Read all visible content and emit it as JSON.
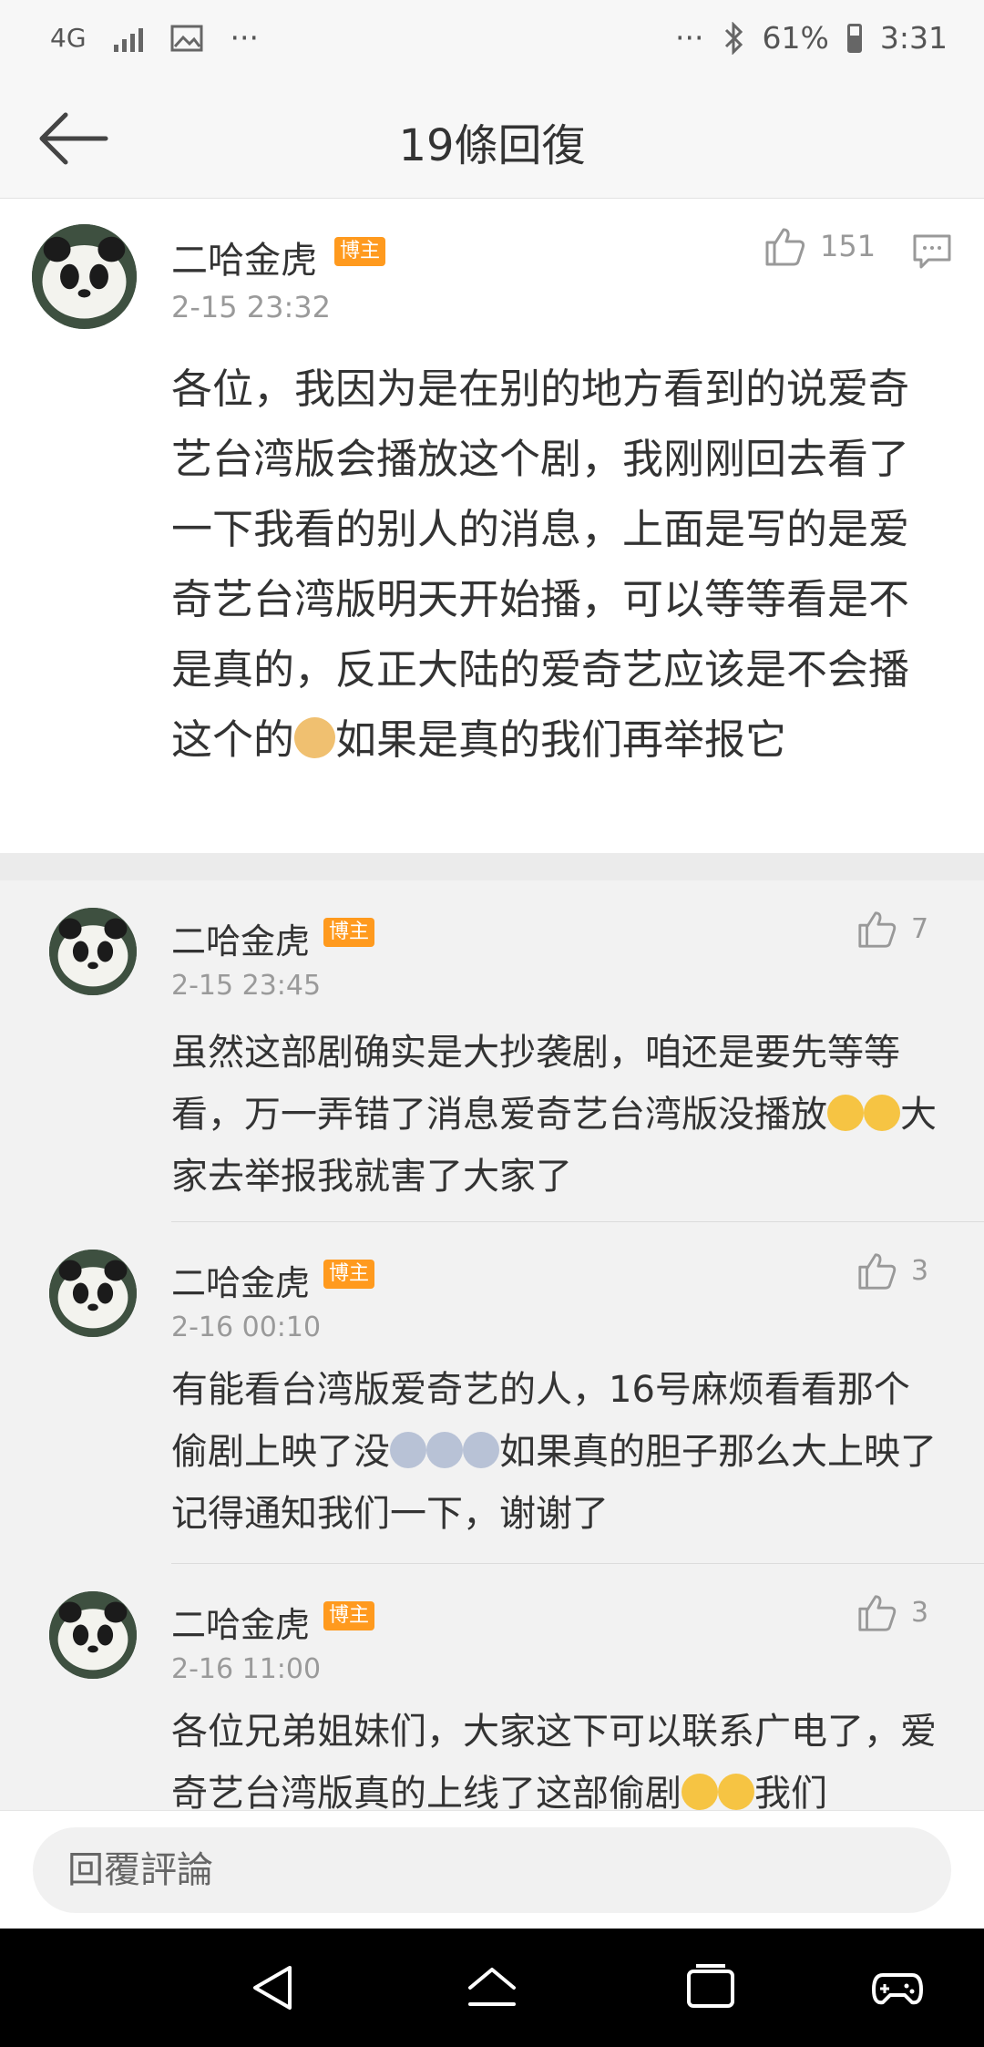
{
  "status_bar": {
    "network": "4G",
    "more": "···",
    "more_right": "···",
    "bluetooth": "✱",
    "battery": "61%",
    "time": "3:31"
  },
  "header": {
    "title": "19條回復"
  },
  "main_comment": {
    "author": "二哈金虎",
    "badge": "博主",
    "time": "2-15 23:32",
    "likes": "151",
    "text_before_emoji": "各位，我因为是在别的地方看到的说爱奇艺台湾版会播放这个剧，我刚刚回去看了一下我看的别人的消息，上面是写的是爱奇艺台湾版明天开始播，可以等等看是不是真的，反正大陆的爱奇艺应该是不会播这个的",
    "text_after_emoji": "如果是真的我们再举报它"
  },
  "replies": [
    {
      "author": "二哈金虎",
      "badge": "博主",
      "time": "2-15 23:45",
      "likes": "7",
      "text_a": "虽然这部剧确实是大抄袭剧，咱还是要先等等看，万一弄错了消息爱奇艺台湾版没播放",
      "text_b": "大家去举报我就害了大家了"
    },
    {
      "author": "二哈金虎",
      "badge": "博主",
      "time": "2-16 00:10",
      "likes": "3",
      "text_a": "有能看台湾版爱奇艺的人，16号麻烦看看那个偷剧上映了没",
      "text_b": "如果真的胆子那么大上映了记得通知我们一下，谢谢了"
    },
    {
      "author": "二哈金虎",
      "badge": "博主",
      "time": "2-16 11:00",
      "likes": "3",
      "text_a": "各位兄弟姐妹们，大家这下可以联系广电了，爱奇艺台湾版真的上线了这部偷剧",
      "text_b": "我们"
    }
  ],
  "input": {
    "placeholder": "回覆評論"
  },
  "colors": {
    "badge": "#ff9a1e",
    "background": "#f2f2f2"
  }
}
